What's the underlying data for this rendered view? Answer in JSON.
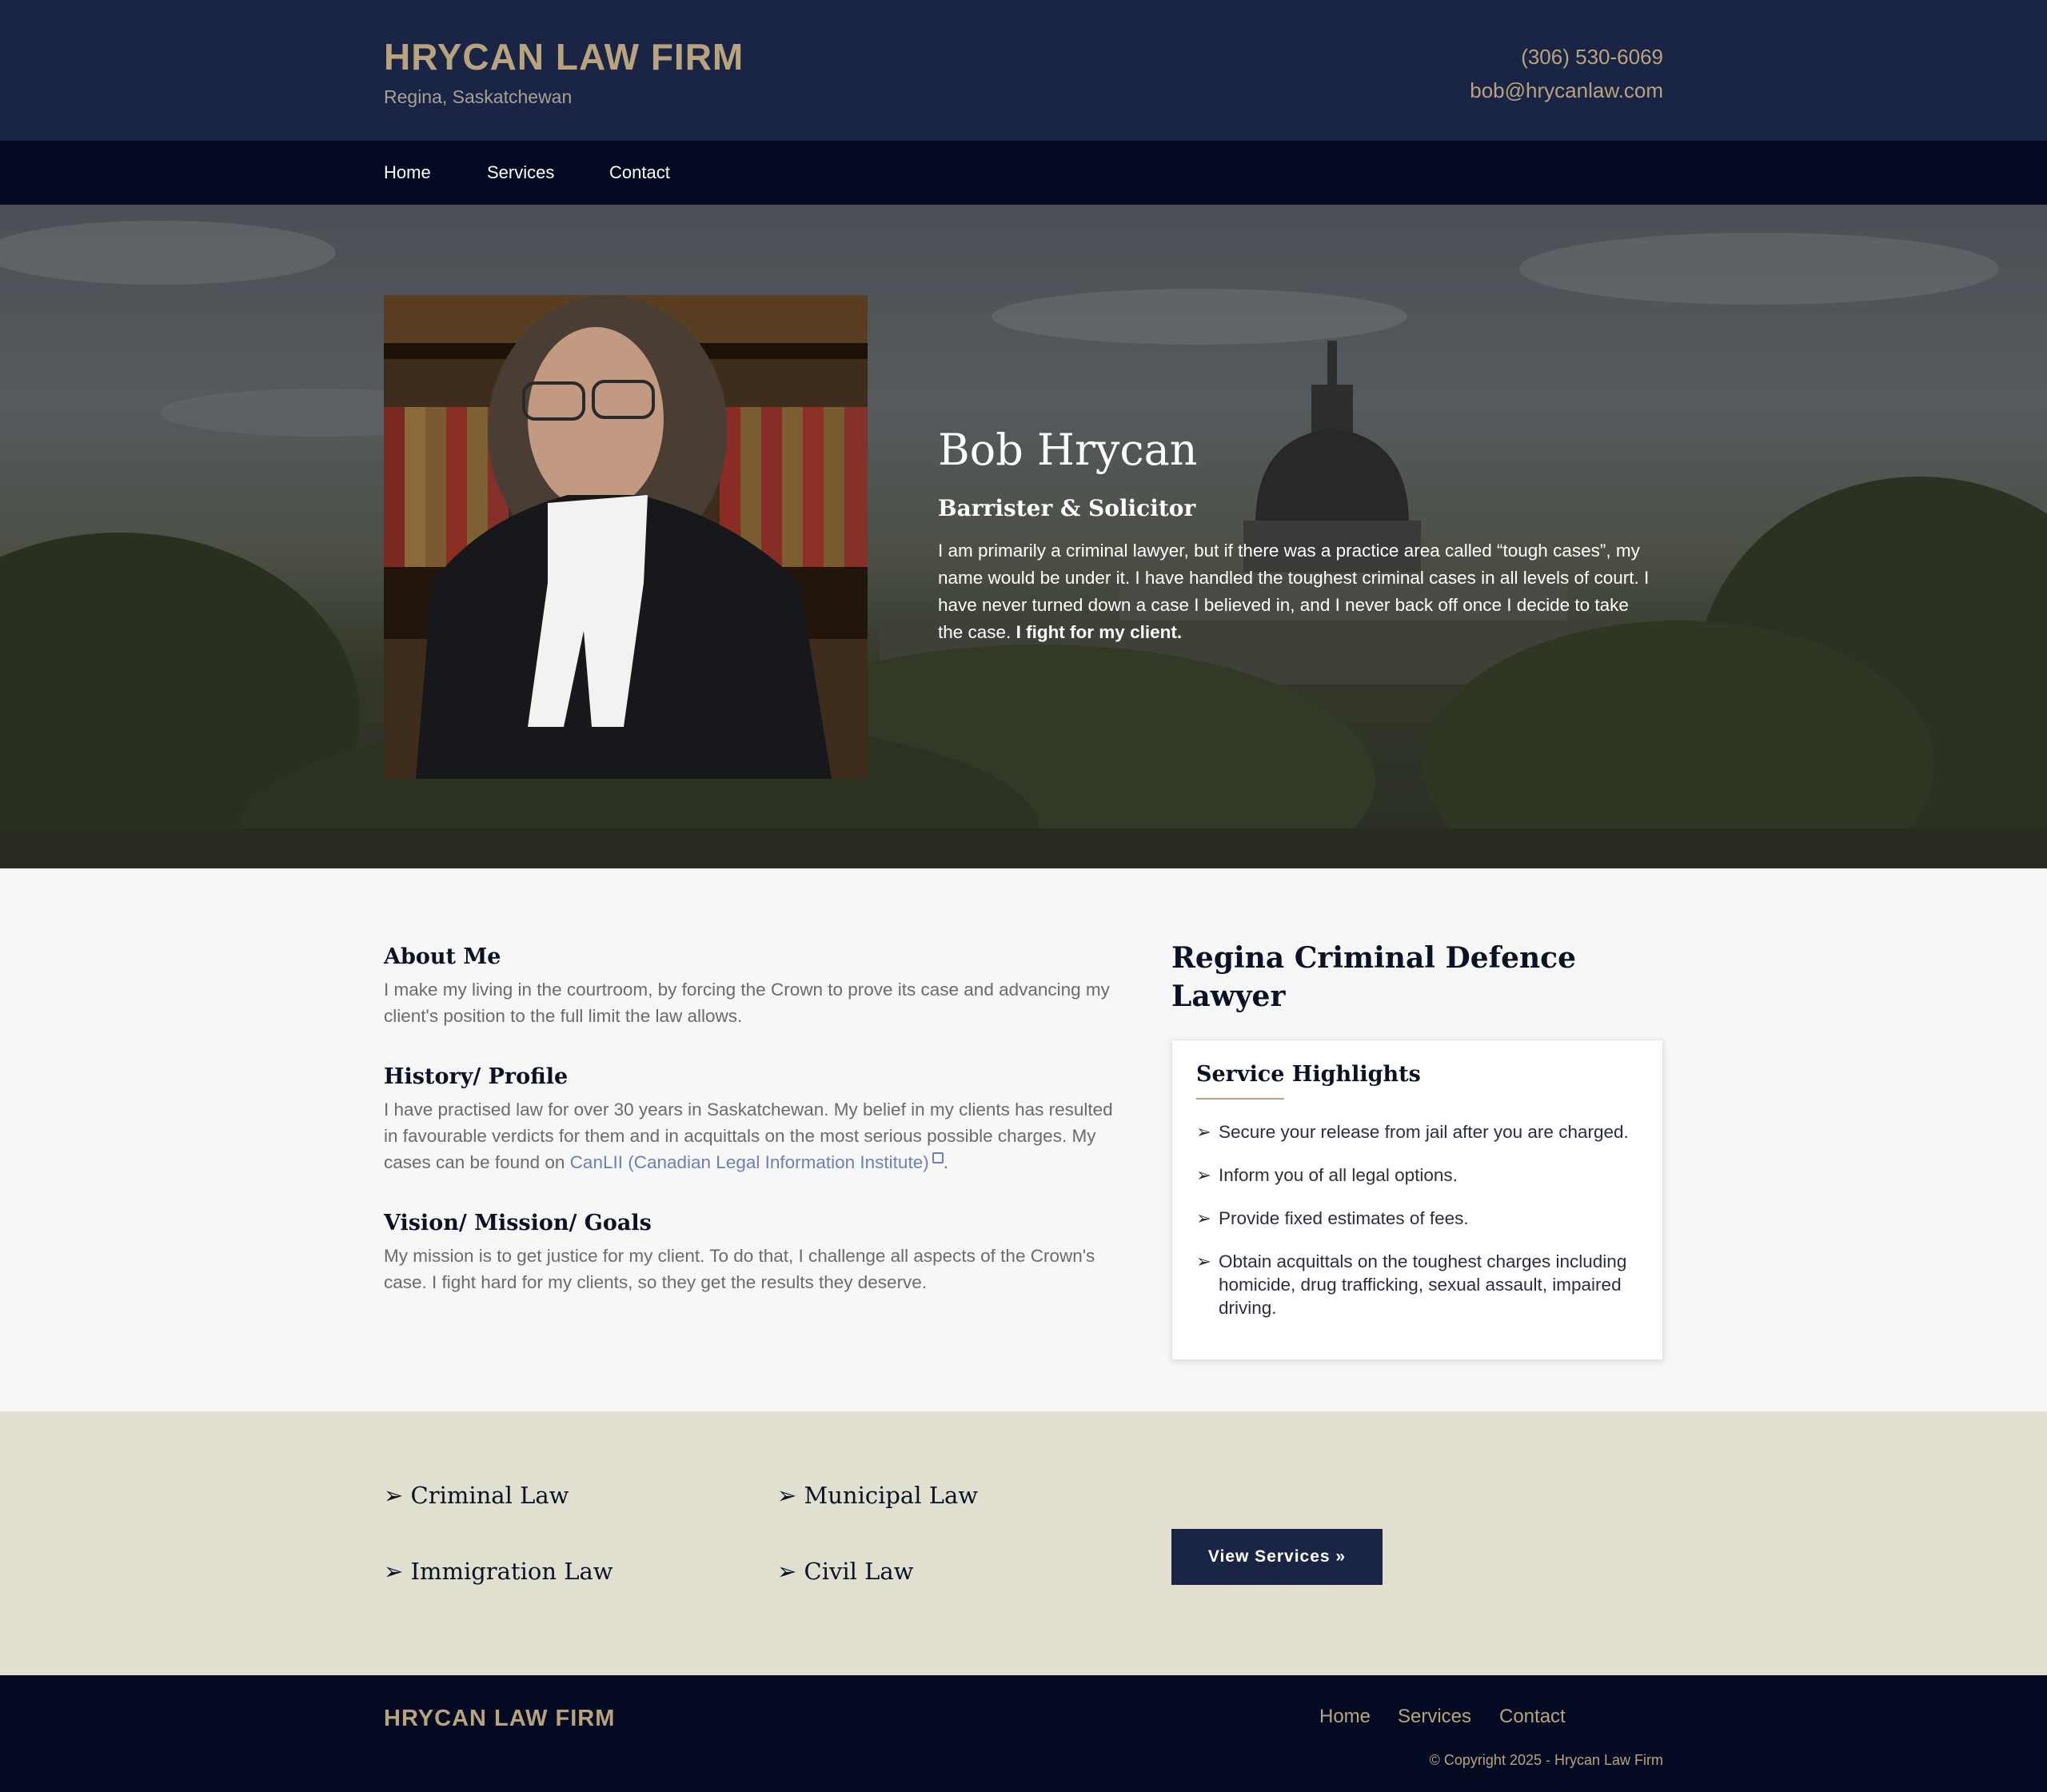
{
  "header": {
    "brand": "HRYCAN LAW FIRM",
    "location": "Regina, Saskatchewan",
    "phone": "(306) 530-6069",
    "email": "bob@hrycanlaw.com"
  },
  "nav": {
    "items": [
      "Home",
      "Services",
      "Contact"
    ]
  },
  "hero": {
    "name": "Bob Hrycan",
    "title": "Barrister & Solicitor",
    "body": "I am primarily a criminal lawyer, but if there was a practice area called “tough cases”, my name would be under it. I have handled the toughest criminal cases in all levels of court. I have never turned down a case I believed in, and I never back off once I decide to take the case.",
    "body_strong": "I fight for my client."
  },
  "about": {
    "sections": [
      {
        "heading": "About Me",
        "text": "I make my living in the courtroom, by forcing the Crown to prove its case and advancing my client's position to the full limit the law allows."
      },
      {
        "heading": "History/ Profile",
        "text": "I have practised law for over 30 years in Saskatchewan. My belief in my clients has resulted in favourable verdicts for them and in acquittals on the most serious possible charges. My cases can be found on",
        "link": "CanLII (Canadian Legal Information Institute)",
        "after": "."
      },
      {
        "heading": "Vision/ Mission/ Goals",
        "text": "My mission is to get justice for my client. To do that, I challenge all aspects of the Crown's case. I fight hard for my clients, so they get the results they deserve."
      }
    ]
  },
  "sidebar": {
    "title": "Regina Criminal Defence Lawyer",
    "card_heading": "Service Highlights",
    "bullet": "➢",
    "items": [
      "Secure your release from jail after you are charged.",
      "Inform you of all legal options.",
      "Provide fixed estimates of fees.",
      "Obtain acquittals on the toughest charges including homicide, drug trafficking, sexual assault, impaired driving."
    ]
  },
  "practice": {
    "areas": [
      "➢ Criminal Law",
      "➢ Municipal Law",
      "➢ Immigration Law",
      "➢ Civil Law"
    ],
    "button": "View Services »"
  },
  "footer": {
    "brand": "HRYCAN LAW FIRM",
    "nav": [
      "Home",
      "Services",
      "Contact"
    ],
    "copyright": "© Copyright 2025 - Hrycan Law Firm"
  },
  "colors": {
    "navy": "#1a2546",
    "dark_navy": "#030a22",
    "gold": "#b8a37e",
    "beige": "#e0dfd0",
    "link": "#6c7fb6"
  }
}
